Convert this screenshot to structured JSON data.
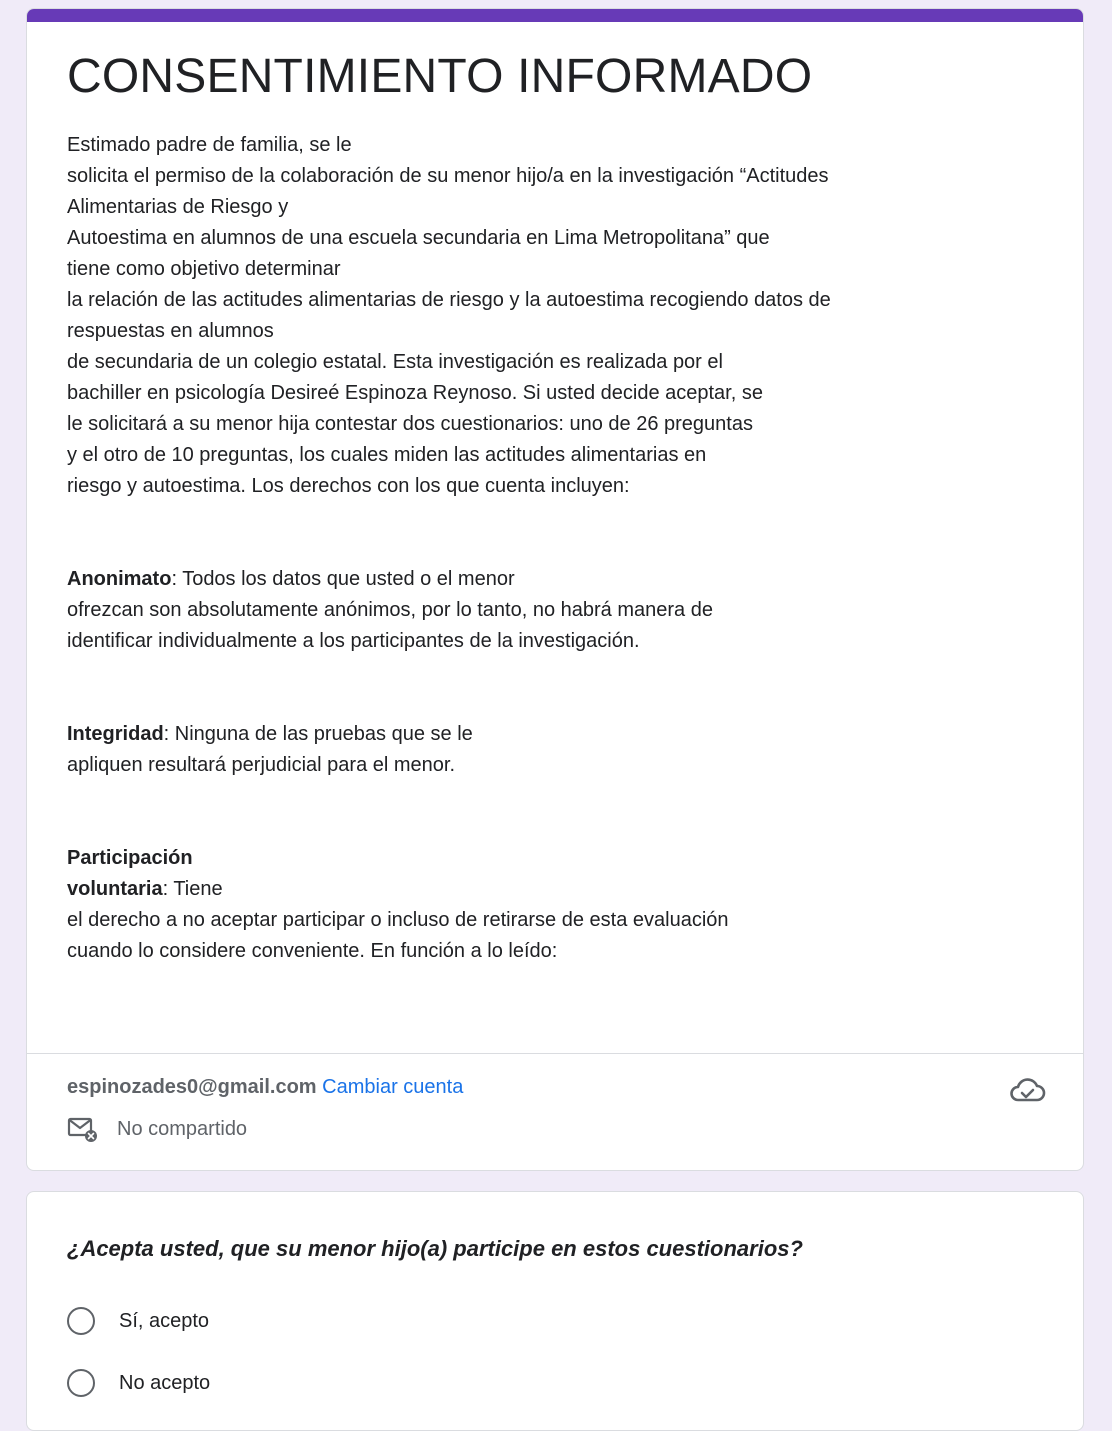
{
  "form": {
    "title": "CONSENTIMIENTO INFORMADO",
    "description_lines": [
      "Estimado padre de familia, se le",
      "solicita el permiso de la colaboración de su menor hijo/a en la investigación “Actitudes",
      "Alimentarias de Riesgo y",
      "Autoestima en alumnos de una escuela secundaria en Lima Metropolitana” que",
      "tiene como objetivo determinar",
      "la relación de las actitudes alimentarias de riesgo y la autoestima recogiendo datos de",
      "respuestas en alumnos",
      "de secundaria de un colegio estatal. Esta investigación es realizada por el",
      "bachiller en psicología Desireé Espinoza Reynoso. Si usted decide aceptar, se",
      "le solicitará a su menor hija contestar dos cuestionarios: uno de 26 preguntas",
      "y el otro de 10 preguntas, los cuales miden las actitudes alimentarias en",
      "riesgo y autoestima. Los derechos con los que cuenta incluyen:"
    ],
    "anonimato": {
      "term": "Anonimato",
      "text_1": ": Todos los datos que usted o el menor",
      "line_2": "ofrezcan son absolutamente anónimos, por lo tanto, no habrá manera de",
      "line_3": "identificar individualmente a los participantes de la investigación."
    },
    "integridad": {
      "term": "Integridad",
      "text_1": ": Ninguna de las pruebas que se le",
      "line_2": "apliquen resultará perjudicial para el menor."
    },
    "participacion": {
      "term_1": "Participación",
      "term_2": "voluntaria",
      "text_2": ": Tiene",
      "line_3": "el derecho a no aceptar participar o incluso de retirarse de esta evaluación",
      "line_4": "cuando lo considere conveniente. En función a lo leído:"
    }
  },
  "account": {
    "email": "espinozades0@gmail.com",
    "switch_label": "Cambiar cuenta",
    "shared_status": "No compartido",
    "cloud_icon": "cloud-saved-icon",
    "mail_icon": "mail-not-shared-icon"
  },
  "question": {
    "title": "¿Acepta usted, que su menor hijo(a) participe en estos cuestionarios?",
    "options": [
      {
        "label": "Sí, acepto"
      },
      {
        "label": "No acepto"
      }
    ]
  },
  "colors": {
    "accent": "#673ab7",
    "background": "#f0ebf8",
    "link": "#1a73e8"
  }
}
